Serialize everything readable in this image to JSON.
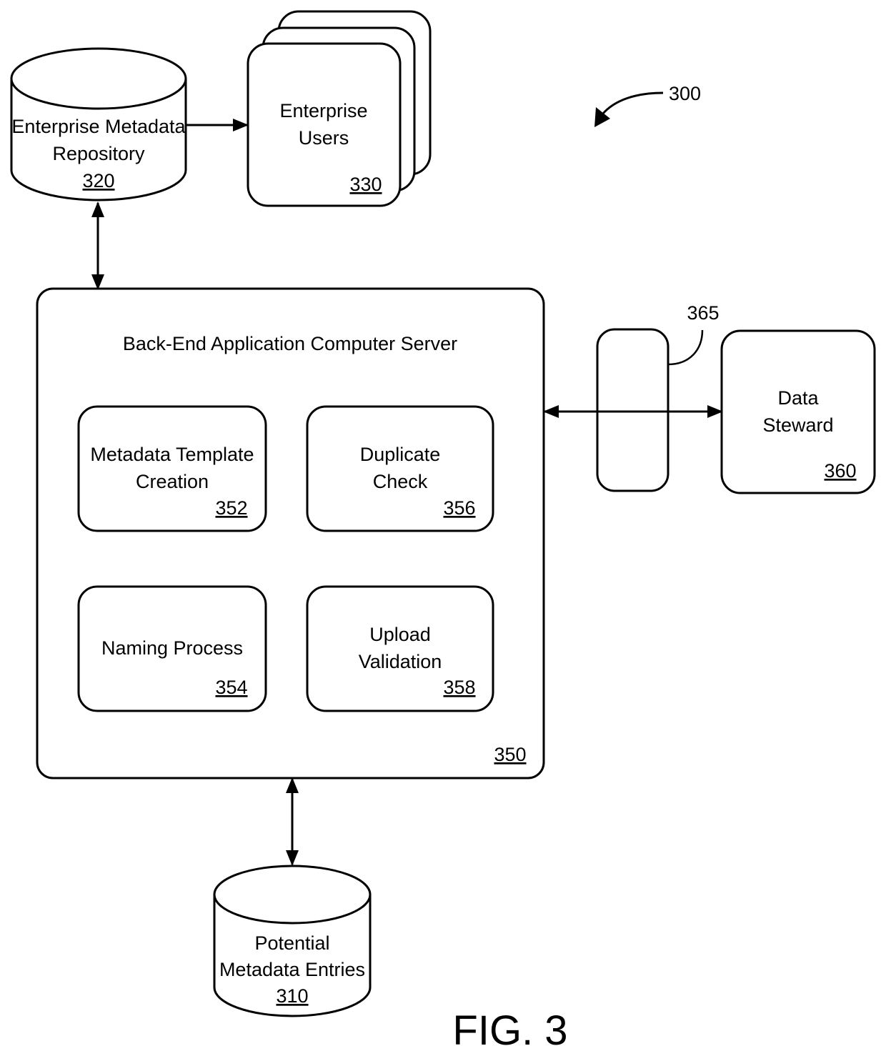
{
  "figure": {
    "caption": "FIG. 3",
    "reference": "300"
  },
  "nodes": {
    "repository": {
      "line1": "Enterprise Metadata",
      "line2": "Repository",
      "ref": "320"
    },
    "users": {
      "line1": "Enterprise",
      "line2": "Users",
      "ref": "330"
    },
    "server": {
      "title": "Back-End Application Computer Server",
      "ref": "350"
    },
    "template": {
      "line1": "Metadata Template",
      "line2": "Creation",
      "ref": "352"
    },
    "naming": {
      "line1": "Naming Process",
      "ref": "354"
    },
    "duplicate": {
      "line1": "Duplicate",
      "line2": "Check",
      "ref": "356"
    },
    "upload": {
      "line1": "Upload",
      "line2": "Validation",
      "ref": "358"
    },
    "steward": {
      "line1": "Data",
      "line2": "Steward",
      "ref": "360"
    },
    "interface": {
      "ref": "365"
    },
    "entries": {
      "line1": "Potential",
      "line2": "Metadata Entries",
      "ref": "310"
    }
  },
  "connections": [
    {
      "from": "repository",
      "to": "users",
      "direction": "one-way"
    },
    {
      "from": "repository",
      "to": "server",
      "direction": "two-way"
    },
    {
      "from": "server",
      "to": "steward",
      "direction": "two-way",
      "via": "interface"
    },
    {
      "from": "server",
      "to": "entries",
      "direction": "two-way"
    }
  ]
}
